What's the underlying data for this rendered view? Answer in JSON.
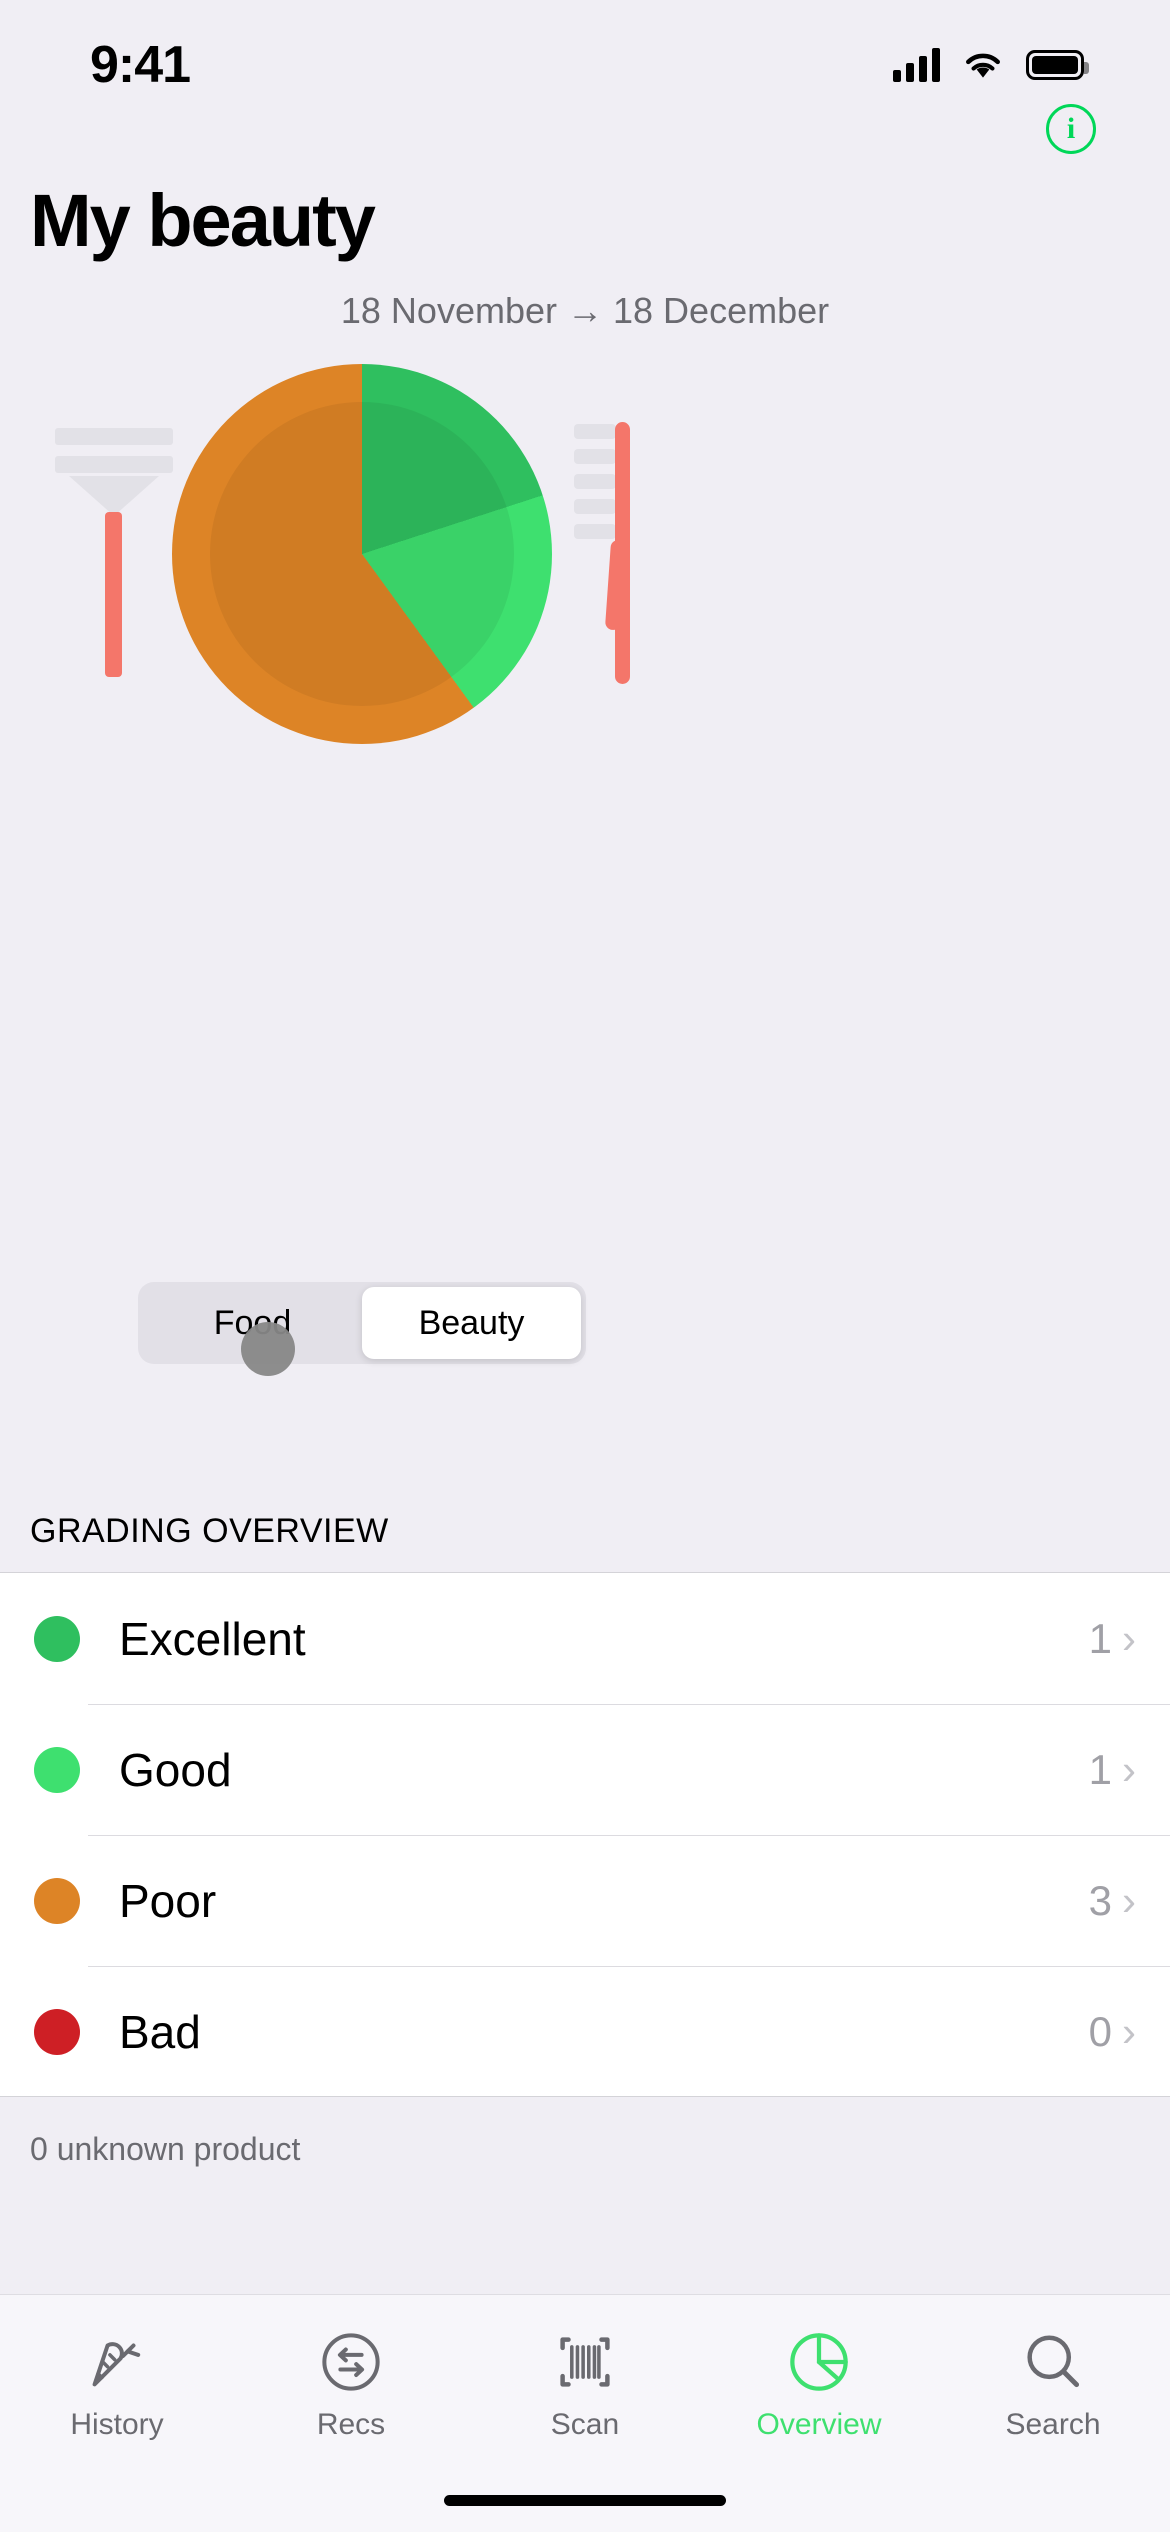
{
  "status_bar": {
    "time": "9:41",
    "signal_icon": "cellular-signal-icon",
    "wifi_icon": "wifi-icon",
    "battery_icon": "battery-full-icon"
  },
  "header": {
    "info_button_label": "i",
    "info_button_icon": "info-circle-icon",
    "title": "My beauty",
    "date_range": "18 November → 18 December"
  },
  "chart_data": {
    "type": "pie",
    "title": "My beauty",
    "subtitle": "18 November → 18 December",
    "categories": [
      "Excellent",
      "Good",
      "Poor",
      "Bad"
    ],
    "values": [
      1,
      1,
      3,
      0
    ],
    "colors": [
      "#2FBF5F",
      "#3EE06F",
      "#DD8426",
      "#CE1F25"
    ],
    "total": 5,
    "start_angle_deg": 0,
    "direction": "clockwise",
    "slices": [
      {
        "label": "Excellent",
        "value": 1,
        "color": "#2FBF5F",
        "start_deg": 0,
        "end_deg": 72
      },
      {
        "label": "Good",
        "value": 1,
        "color": "#3EE06F",
        "start_deg": 72,
        "end_deg": 144
      },
      {
        "label": "Poor",
        "value": 3,
        "color": "#DD8426",
        "start_deg": 144,
        "end_deg": 360
      },
      {
        "label": "Bad",
        "value": 0,
        "color": "#CE1F25",
        "start_deg": 360,
        "end_deg": 360
      }
    ],
    "legend_position": "below-as-list",
    "grid": false,
    "decor_icons": [
      "makeup-brush-icon",
      "toothbrush-icon"
    ]
  },
  "segmented_control": {
    "options": [
      "Food",
      "Beauty"
    ],
    "selected": "Beauty",
    "food_label": "Food",
    "beauty_label": "Beauty"
  },
  "grading": {
    "section_title": "GRADING OVERVIEW",
    "rows": [
      {
        "label": "Excellent",
        "count": "1",
        "color": "#2FBF5F",
        "chevron": "›"
      },
      {
        "label": "Good",
        "count": "1",
        "color": "#3EE06F",
        "chevron": "›"
      },
      {
        "label": "Poor",
        "count": "3",
        "color": "#DD8426",
        "chevron": "›"
      },
      {
        "label": "Bad",
        "count": "0",
        "color": "#CE1F25",
        "chevron": "›"
      }
    ],
    "footer_note": "0 unknown product"
  },
  "tabbar": {
    "items": [
      {
        "label": "History",
        "icon": "carrot-icon",
        "active": false
      },
      {
        "label": "Recs",
        "icon": "swap-arrows-circle-icon",
        "active": false
      },
      {
        "label": "Scan",
        "icon": "barcode-scan-icon",
        "active": false
      },
      {
        "label": "Overview",
        "icon": "pie-chart-icon",
        "active": true
      },
      {
        "label": "Search",
        "icon": "magnifier-icon",
        "active": false
      }
    ],
    "active_color": "#3EE06F",
    "inactive_color": "#6a6a70"
  }
}
